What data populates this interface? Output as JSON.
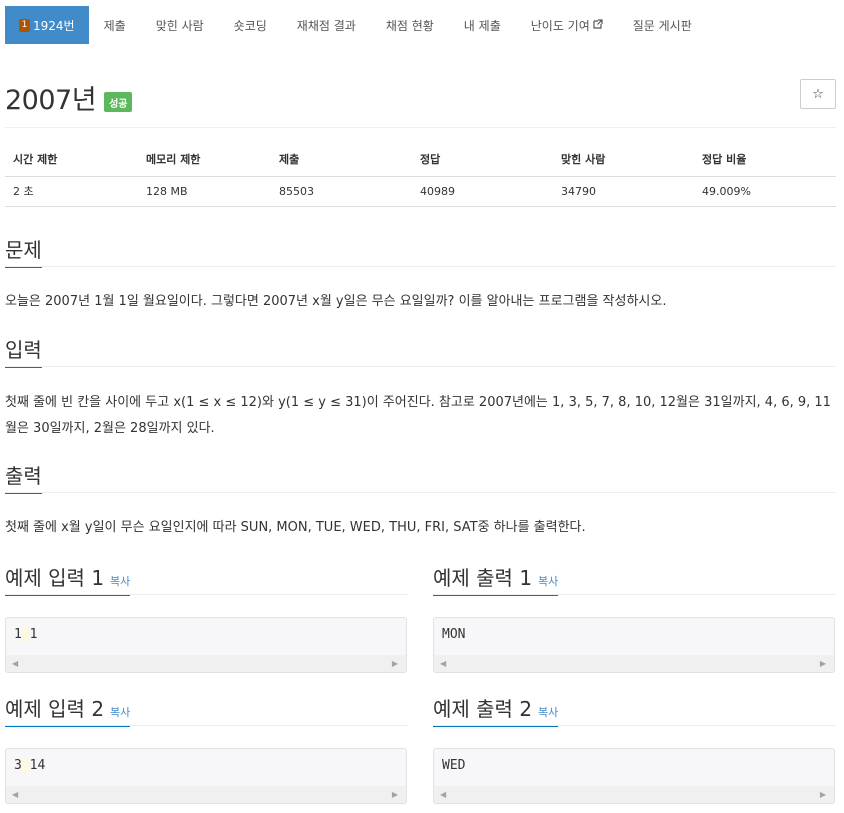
{
  "nav": {
    "items": [
      {
        "label": "1924번",
        "active": true
      },
      {
        "label": "제출"
      },
      {
        "label": "맞힌 사람"
      },
      {
        "label": "숏코딩"
      },
      {
        "label": "재채점 결과"
      },
      {
        "label": "채점 현황"
      },
      {
        "label": "내 제출"
      },
      {
        "label": "난이도 기여",
        "icon": "external-link-icon"
      },
      {
        "label": "질문 게시판"
      }
    ]
  },
  "title": {
    "text": "2007년",
    "badge": "성공",
    "star": "☆"
  },
  "info": {
    "headers": [
      "시간 제한",
      "메모리 제한",
      "제출",
      "정답",
      "맞힌 사람",
      "정답 비율"
    ],
    "values": [
      "2 초",
      "128 MB",
      "85503",
      "40989",
      "34790",
      "49.009%"
    ]
  },
  "sections": {
    "problem": {
      "title": "문제",
      "body": "오늘은 2007년 1월 1일 월요일이다. 그렇다면 2007년 x월 y일은 무슨 요일일까? 이를 알아내는 프로그램을 작성하시오."
    },
    "input": {
      "title": "입력",
      "body": "첫째 줄에 빈 칸을 사이에 두고 x(1 ≤ x ≤ 12)와 y(1 ≤ y ≤ 31)이 주어진다. 참고로 2007년에는 1, 3, 5, 7, 8, 10, 12월은 31일까지, 4, 6, 9, 11월은 30일까지, 2월은 28일까지 있다."
    },
    "output": {
      "title": "출력",
      "body": "첫째 줄에 x월 y일이 무슨 요일인지에 따라 SUN, MON, TUE, WED, THU, FRI, SAT중 하나를 출력한다."
    }
  },
  "samples": {
    "copy_label": "복사",
    "in1": {
      "title": "예제 입력 1",
      "a": "1",
      "b": "1"
    },
    "out1": {
      "title": "예제 출력 1",
      "text": "MON"
    },
    "in2": {
      "title": "예제 입력 2",
      "a": "3",
      "b": "14"
    },
    "out2": {
      "title": "예제 출력 2",
      "text": "WED"
    }
  },
  "colors": {
    "accent": "#428bca",
    "success": "#5cb85c",
    "heading_underline": "#0078c0"
  }
}
